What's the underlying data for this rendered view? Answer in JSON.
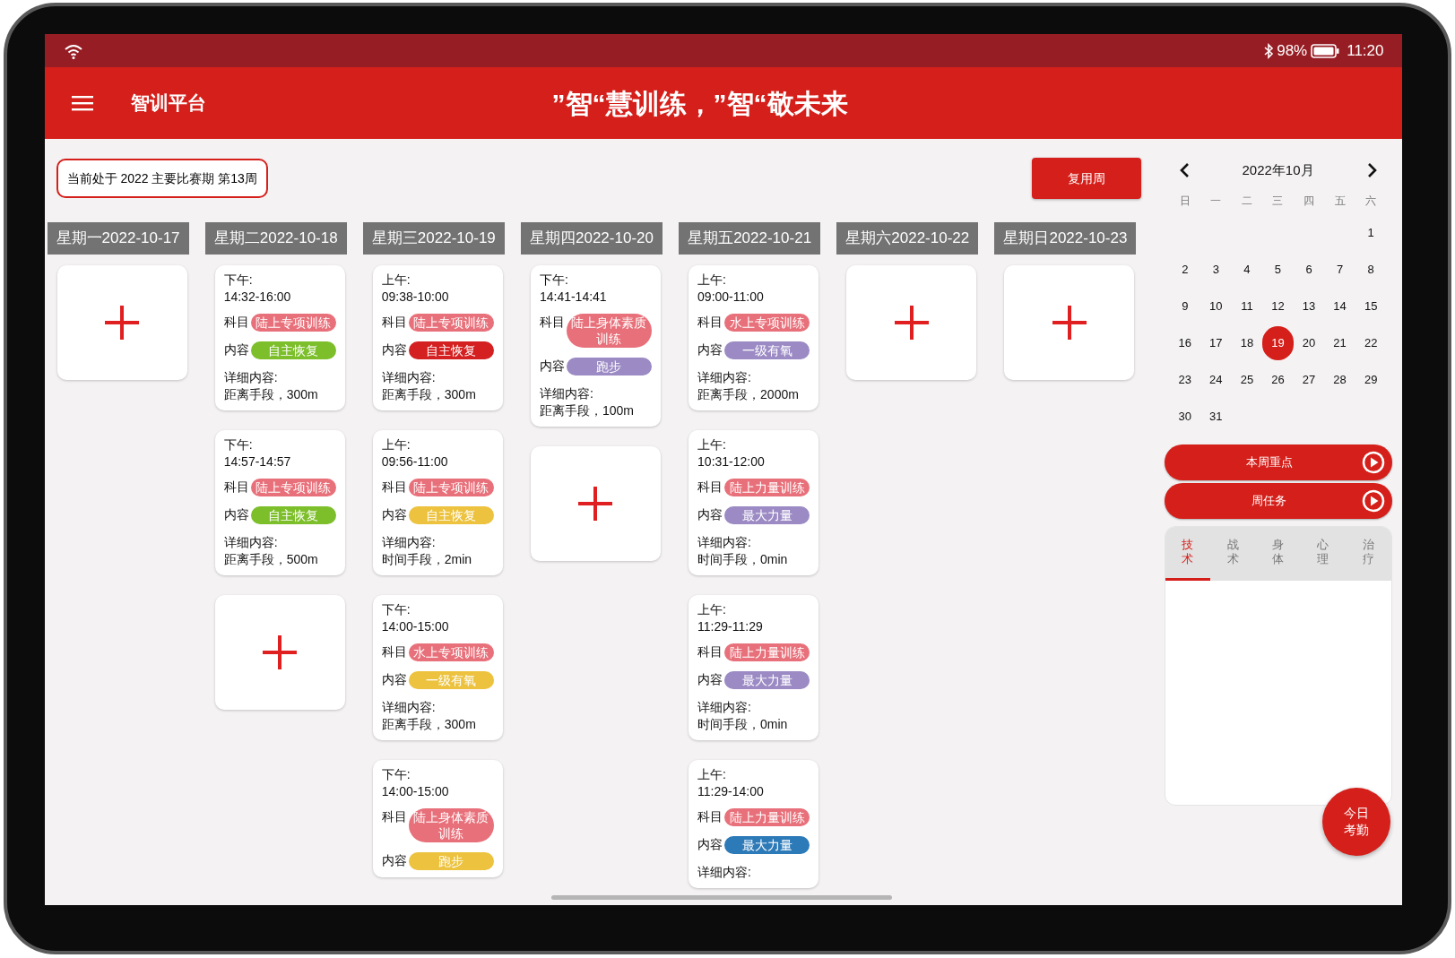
{
  "status_bar": {
    "battery": "98%",
    "time": "11:20"
  },
  "header": {
    "app_name": "智训平台",
    "title": "”智“慧训练，”智“敬未来"
  },
  "period_badge": "当前处于 2022 主要比赛期 第13周",
  "reuse_button": "复用周",
  "days": [
    {
      "label": "星期一2022-10-17",
      "entries": [
        {
          "kind": "add"
        }
      ]
    },
    {
      "label": "星期二2022-10-18",
      "entries": [
        {
          "kind": "session",
          "period": "下午:",
          "time": "14:32-16:00",
          "subject_label": "科目",
          "subject": {
            "text": "陆上专项训练",
            "color": "#e8707a"
          },
          "content_label": "内容",
          "content": {
            "text": "自主恢复",
            "color": "#7cbf2a"
          },
          "detail_label": "详细内容:",
          "detail": "距离手段，300m"
        },
        {
          "kind": "session",
          "period": "下午:",
          "time": "14:57-14:57",
          "subject_label": "科目",
          "subject": {
            "text": "陆上专项训练",
            "color": "#e8707a"
          },
          "content_label": "内容",
          "content": {
            "text": "自主恢复",
            "color": "#7cbf2a"
          },
          "detail_label": "详细内容:",
          "detail": "距离手段，500m"
        },
        {
          "kind": "add"
        }
      ]
    },
    {
      "label": "星期三2022-10-19",
      "entries": [
        {
          "kind": "session",
          "period": "上午:",
          "time": "09:38-10:00",
          "subject_label": "科目",
          "subject": {
            "text": "陆上专项训练",
            "color": "#e8707a"
          },
          "content_label": "内容",
          "content": {
            "text": "自主恢复",
            "color": "#d42020"
          },
          "detail_label": "详细内容:",
          "detail": "距离手段，300m"
        },
        {
          "kind": "session",
          "period": "上午:",
          "time": "09:56-11:00",
          "subject_label": "科目",
          "subject": {
            "text": "陆上专项训练",
            "color": "#e8707a"
          },
          "content_label": "内容",
          "content": {
            "text": "自主恢复",
            "color": "#ecc23e"
          },
          "detail_label": "详细内容:",
          "detail": "时间手段，2min"
        },
        {
          "kind": "session",
          "period": "下午:",
          "time": "14:00-15:00",
          "subject_label": "科目",
          "subject": {
            "text": "水上专项训练",
            "color": "#e8707a"
          },
          "content_label": "内容",
          "content": {
            "text": "一级有氧",
            "color": "#ecc23e"
          },
          "detail_label": "详细内容:",
          "detail": "距离手段，300m"
        },
        {
          "kind": "session",
          "period": "下午:",
          "time": "14:00-15:00",
          "subject_label": "科目",
          "subject": {
            "text": "陆上身体素质训练",
            "color": "#e8707a"
          },
          "content_label": "内容",
          "content": {
            "text": "跑步",
            "color": "#ecc23e"
          }
        }
      ]
    },
    {
      "label": "星期四2022-10-20",
      "entries": [
        {
          "kind": "session",
          "period": "下午:",
          "time": "14:41-14:41",
          "subject_label": "科目",
          "subject": {
            "text": "陆上身体素质训练",
            "color": "#e8707a"
          },
          "content_label": "内容",
          "content": {
            "text": "跑步",
            "color": "#9b8ac4"
          },
          "detail_label": "详细内容:",
          "detail": "距离手段，100m"
        },
        {
          "kind": "add"
        }
      ]
    },
    {
      "label": "星期五2022-10-21",
      "entries": [
        {
          "kind": "session",
          "period": "上午:",
          "time": "09:00-11:00",
          "subject_label": "科目",
          "subject": {
            "text": "水上专项训练",
            "color": "#e8707a"
          },
          "content_label": "内容",
          "content": {
            "text": "一级有氧",
            "color": "#9b8ac4"
          },
          "detail_label": "详细内容:",
          "detail": "距离手段，2000m"
        },
        {
          "kind": "session",
          "period": "上午:",
          "time": "10:31-12:00",
          "subject_label": "科目",
          "subject": {
            "text": "陆上力量训练",
            "color": "#e8707a"
          },
          "content_label": "内容",
          "content": {
            "text": "最大力量",
            "color": "#9b8ac4"
          },
          "detail_label": "详细内容:",
          "detail": "时间手段，0min"
        },
        {
          "kind": "session",
          "period": "上午:",
          "time": "11:29-11:29",
          "subject_label": "科目",
          "subject": {
            "text": "陆上力量训练",
            "color": "#e8707a"
          },
          "content_label": "内容",
          "content": {
            "text": "最大力量",
            "color": "#9b8ac4"
          },
          "detail_label": "详细内容:",
          "detail": "时间手段，0min"
        },
        {
          "kind": "session",
          "period": "上午:",
          "time": "11:29-14:00",
          "subject_label": "科目",
          "subject": {
            "text": "陆上力量训练",
            "color": "#e8707a"
          },
          "content_label": "内容",
          "content": {
            "text": "最大力量",
            "color": "#2d7ab8"
          },
          "detail_label": "详细内容:"
        }
      ]
    },
    {
      "label": "星期六2022-10-22",
      "entries": [
        {
          "kind": "add"
        }
      ]
    },
    {
      "label": "星期日2022-10-23",
      "entries": [
        {
          "kind": "add"
        }
      ]
    }
  ],
  "calendar": {
    "month": "2022年10月",
    "weekdays": [
      "日",
      "一",
      "二",
      "三",
      "四",
      "五",
      "六"
    ],
    "weeks": [
      [
        {
          "day": "1",
          "selected": false
        }
      ],
      [
        {
          "day": "2",
          "selected": false
        },
        {
          "day": "3",
          "selected": false
        },
        {
          "day": "4",
          "selected": false
        },
        {
          "day": "5",
          "selected": false
        },
        {
          "day": "6",
          "selected": false
        },
        {
          "day": "7",
          "selected": false
        },
        {
          "day": "8",
          "selected": false
        }
      ],
      [
        {
          "day": "9",
          "selected": false
        },
        {
          "day": "10",
          "selected": false
        },
        {
          "day": "11",
          "selected": false
        },
        {
          "day": "12",
          "selected": false
        },
        {
          "day": "13",
          "selected": false
        },
        {
          "day": "14",
          "selected": false
        },
        {
          "day": "15",
          "selected": false
        }
      ],
      [
        {
          "day": "16",
          "selected": false
        },
        {
          "day": "17",
          "selected": false
        },
        {
          "day": "18",
          "selected": false
        },
        {
          "day": "19",
          "selected": true
        },
        {
          "day": "20",
          "selected": false
        },
        {
          "day": "21",
          "selected": false
        },
        {
          "day": "22",
          "selected": false
        }
      ],
      [
        {
          "day": "23",
          "selected": false
        },
        {
          "day": "24",
          "selected": false
        },
        {
          "day": "25",
          "selected": false
        },
        {
          "day": "26",
          "selected": false
        },
        {
          "day": "27",
          "selected": false
        },
        {
          "day": "28",
          "selected": false
        },
        {
          "day": "29",
          "selected": false
        }
      ],
      [
        {
          "day": "30",
          "selected": false
        },
        {
          "day": "31",
          "selected": false
        }
      ]
    ]
  },
  "side_buttons": [
    "本周重点",
    "周任务"
  ],
  "category_tabs": [
    {
      "label": "技术",
      "selected": true
    },
    {
      "label": "战术",
      "selected": false
    },
    {
      "label": "身体",
      "selected": false
    },
    {
      "label": "心理",
      "selected": false
    },
    {
      "label": "治疗",
      "selected": false
    }
  ],
  "fab": "今日考勤"
}
